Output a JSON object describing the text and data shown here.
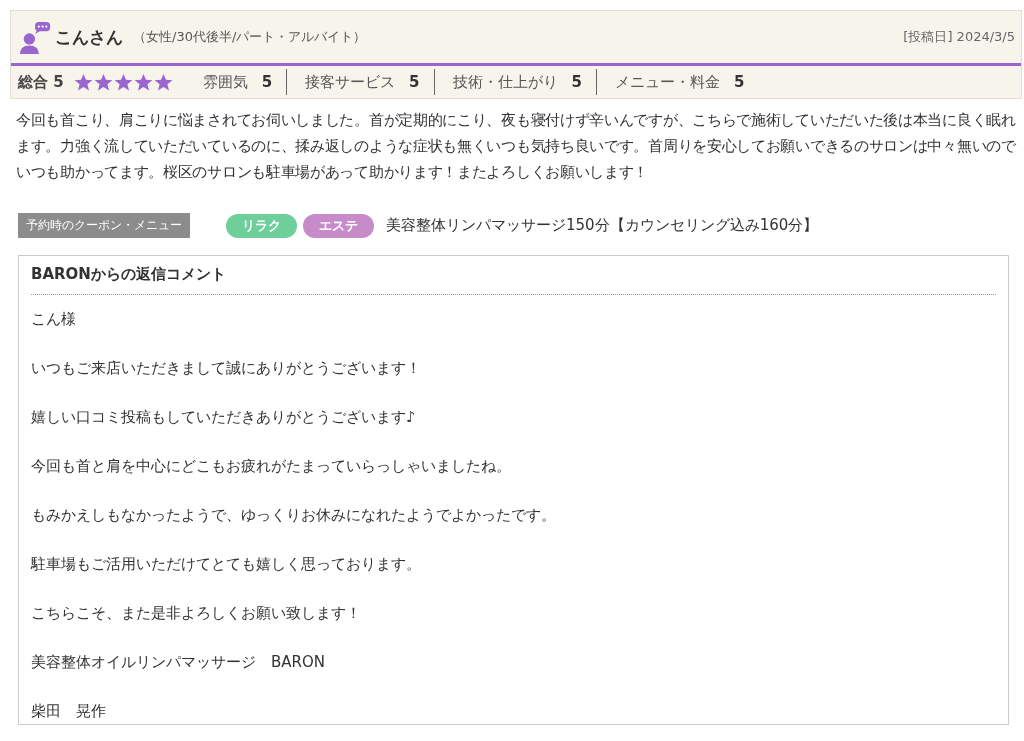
{
  "reviewer": {
    "name": "こんさん",
    "profile": "（女性/30代後半/パート・アルバイト）",
    "posted": "[投稿日] 2024/3/5"
  },
  "overall": {
    "label": "総合",
    "score": "5",
    "stars": 5
  },
  "ratings": [
    {
      "label": "雰囲気",
      "score": "5"
    },
    {
      "label": "接客サービス",
      "score": "5"
    },
    {
      "label": "技術・仕上がり",
      "score": "5"
    },
    {
      "label": "メニュー・料金",
      "score": "5"
    }
  ],
  "review_text": "今回も首こり、肩こりに悩まされてお伺いしました。首が定期的にこり、夜も寝付けず辛いんですが、こちらで施術していただいた後は本当に良く眠れます。力強く流していただいているのに、揉み返しのような症状も無くいつも気持ち良いです。首周りを安心してお願いできるのサロンは中々無いのでいつも助かってます。桜区のサロンも駐車場があって助かります！またよろしくお願いします！",
  "coupon": {
    "label": "予約時のクーポン・メニュー",
    "tags": [
      {
        "text": "リラク",
        "color": "#6fcf9b"
      },
      {
        "text": "エステ",
        "color": "#c88bc9"
      }
    ],
    "menu": "美容整体リンパマッサージ150分【カウンセリング込み160分】"
  },
  "reply": {
    "title": "BARONからの返信コメント",
    "paragraphs": [
      "こん様",
      "いつもご来店いただきまして誠にありがとうございます！",
      "嬉しい口コミ投稿もしていただきありがとうございます♪",
      "今回も首と肩を中心にどこもお疲れがたまっていらっしゃいましたね。",
      "もみかえしもなかったようで、ゆっくりお休みになれたようでよかったです。",
      "駐車場もご活用いただけてとても嬉しく思っております。",
      "こちらこそ、また是非よろしくお願い致します！",
      "美容整体オイルリンパマッサージ　BARON",
      "柴田　晃作"
    ]
  }
}
